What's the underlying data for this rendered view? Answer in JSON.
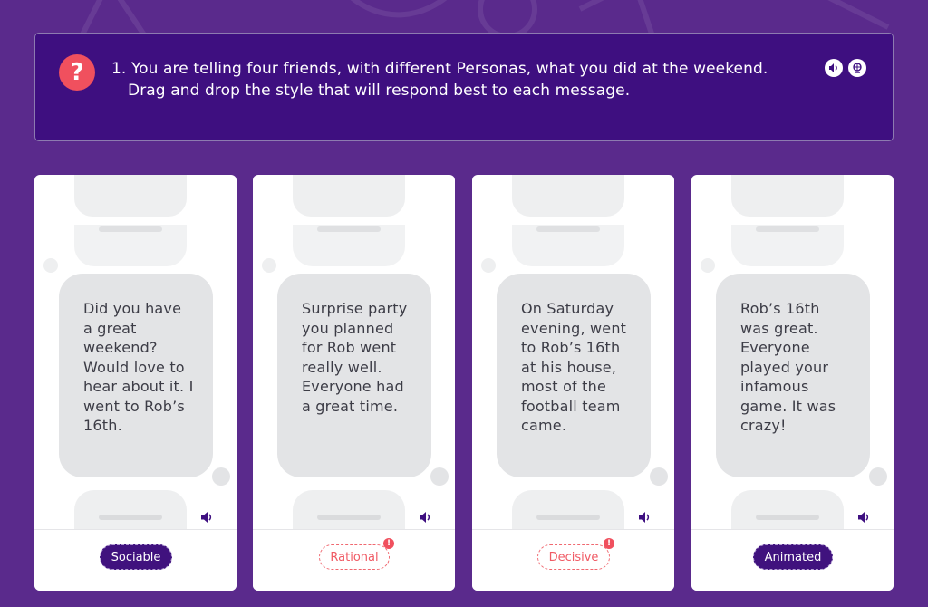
{
  "question": {
    "number": "1.",
    "line1": "You are telling four friends, with different Personas, what you did at the weekend.",
    "line2": "Drag and drop the style that will respond best to each message."
  },
  "icons": {
    "help": "question-mark-icon",
    "audio": "speaker-icon",
    "translate": "globe-icon"
  },
  "colors": {
    "background": "#5a2a8c",
    "question_panel": "#3e0f80",
    "help_icon": "#f0505e",
    "chip_filled": "#40127e",
    "chip_error": "#f05a64"
  },
  "cards": [
    {
      "message": "Did you have a great weekend? Would love to hear about it. I went to Rob’s 16th.",
      "answer": "Sociable",
      "status": "correct"
    },
    {
      "message": "Surprise party you planned for Rob went really well. Everyone had a great time.",
      "answer": "Rational",
      "status": "incorrect",
      "badge": "!"
    },
    {
      "message": "On Saturday evening, went to Rob’s 16th at his house, most of the football team came.",
      "answer": "Decisive",
      "status": "incorrect",
      "badge": "!"
    },
    {
      "message": "Rob’s 16th was great. Everyone played your infamous game. It was crazy!",
      "answer": "Animated",
      "status": "correct"
    }
  ]
}
